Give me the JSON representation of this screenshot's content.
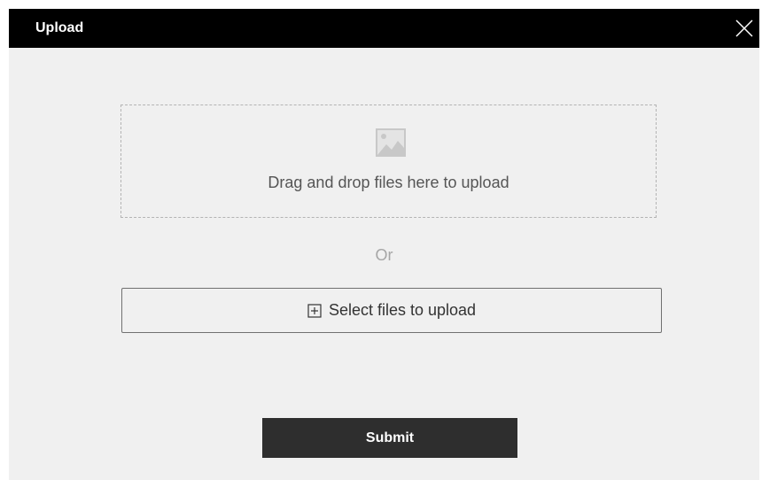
{
  "dialog": {
    "title": "Upload",
    "close_icon": "close-icon"
  },
  "dropzone": {
    "icon": "image-icon",
    "text": "Drag and drop files here to upload"
  },
  "separator": {
    "text": "Or"
  },
  "select_button": {
    "icon": "plus-box-icon",
    "label": "Select files to upload"
  },
  "submit_button": {
    "label": "Submit"
  },
  "colors": {
    "titlebar": "#000000",
    "dialog_background": "#f0f0f0",
    "submit_background": "#2e2e2e",
    "dropzone_border": "#b4b4b4"
  }
}
